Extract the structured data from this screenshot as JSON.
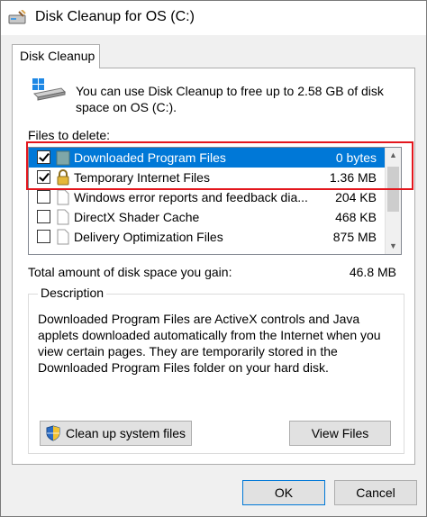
{
  "window": {
    "title": "Disk Cleanup for OS (C:)",
    "icon": "disk-cleanup-icon"
  },
  "tabs": [
    {
      "label": "Disk Cleanup",
      "active": true
    }
  ],
  "intro": {
    "text": "You can use Disk Cleanup to free up to 2.58 GB of disk space on OS (C:).",
    "icon": "drive-icon"
  },
  "files_to_delete": {
    "label": "Files to delete:",
    "items": [
      {
        "name": "Downloaded Program Files",
        "size": "0 bytes",
        "checked": true,
        "selected": true,
        "icon": "folder-icon"
      },
      {
        "name": "Temporary Internet Files",
        "size": "1.36 MB",
        "checked": true,
        "selected": false,
        "icon": "lock-icon"
      },
      {
        "name": "Windows error reports and feedback dia...",
        "size": "204 KB",
        "checked": false,
        "selected": false,
        "icon": "file-icon"
      },
      {
        "name": "DirectX Shader Cache",
        "size": "468 KB",
        "checked": false,
        "selected": false,
        "icon": "file-icon"
      },
      {
        "name": "Delivery Optimization Files",
        "size": "875 MB",
        "checked": false,
        "selected": false,
        "icon": "file-icon"
      }
    ]
  },
  "total": {
    "label": "Total amount of disk space you gain:",
    "value": "46.8 MB"
  },
  "description": {
    "legend": "Description",
    "text": "Downloaded Program Files are ActiveX controls and Java applets downloaded automatically from the Internet when you view certain pages. They are temporarily stored in the Downloaded Program Files folder on your hard disk."
  },
  "buttons": {
    "cleanup_system": "Clean up system files",
    "view_files": "View Files",
    "ok": "OK",
    "cancel": "Cancel"
  },
  "colors": {
    "selection": "#0078d7",
    "highlight_box": "#e3161d",
    "window_bg": "#f0f0f0"
  }
}
